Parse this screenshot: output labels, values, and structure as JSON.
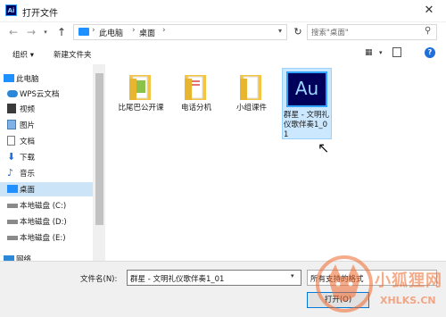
{
  "window": {
    "title": "打开文件",
    "app_icon_text": "Ai",
    "close_label": "✕"
  },
  "nav": {
    "back": "←",
    "forward": "→",
    "up": "↑",
    "breadcrumb": [
      "此电脑",
      "桌面"
    ],
    "separator": "›",
    "refresh": "↻",
    "search_placeholder": "搜索\"桌面\""
  },
  "toolbar": {
    "organize_label": "组织 ▾",
    "new_folder_label": "新建文件夹",
    "help_label": "?"
  },
  "sidebar": {
    "items": [
      {
        "label": "此电脑",
        "icon": "computer-icon"
      },
      {
        "label": "WPS云文档",
        "icon": "cloud-icon"
      },
      {
        "label": "视频",
        "icon": "video-icon"
      },
      {
        "label": "图片",
        "icon": "picture-icon"
      },
      {
        "label": "文档",
        "icon": "document-icon"
      },
      {
        "label": "下载",
        "icon": "download-icon"
      },
      {
        "label": "音乐",
        "icon": "music-icon"
      },
      {
        "label": "桌面",
        "icon": "desktop-icon",
        "selected": true
      },
      {
        "label": "本地磁盘 (C:)",
        "icon": "drive-icon"
      },
      {
        "label": "本地磁盘 (D:)",
        "icon": "drive-icon"
      },
      {
        "label": "本地磁盘 (E:)",
        "icon": "drive-icon"
      },
      {
        "label": "网络",
        "icon": "network-icon"
      }
    ]
  },
  "files": [
    {
      "label": "比尾巴公开课",
      "icon": "folder-icon"
    },
    {
      "label": "电话分机",
      "icon": "folder-icon"
    },
    {
      "label": "小组课件",
      "icon": "folder-icon"
    },
    {
      "label": "群星 - 文明礼仪歌伴奏1_01",
      "icon": "audition-file-icon",
      "icon_text": "Au",
      "selected": true
    }
  ],
  "bottom": {
    "filename_label": "文件名(N):",
    "filename_value": "群星 - 文明礼仪歌伴奏1_01",
    "filetype_value": "所有支持的格式",
    "open_label": "打开(O)"
  },
  "watermark": {
    "title": "小狐狸网",
    "url": "XHLKS.CN"
  },
  "colors": {
    "accent": "#1e6fd9",
    "selection": "#cce8ff",
    "folder": "#f4c542",
    "watermark": "#f06a2c"
  }
}
